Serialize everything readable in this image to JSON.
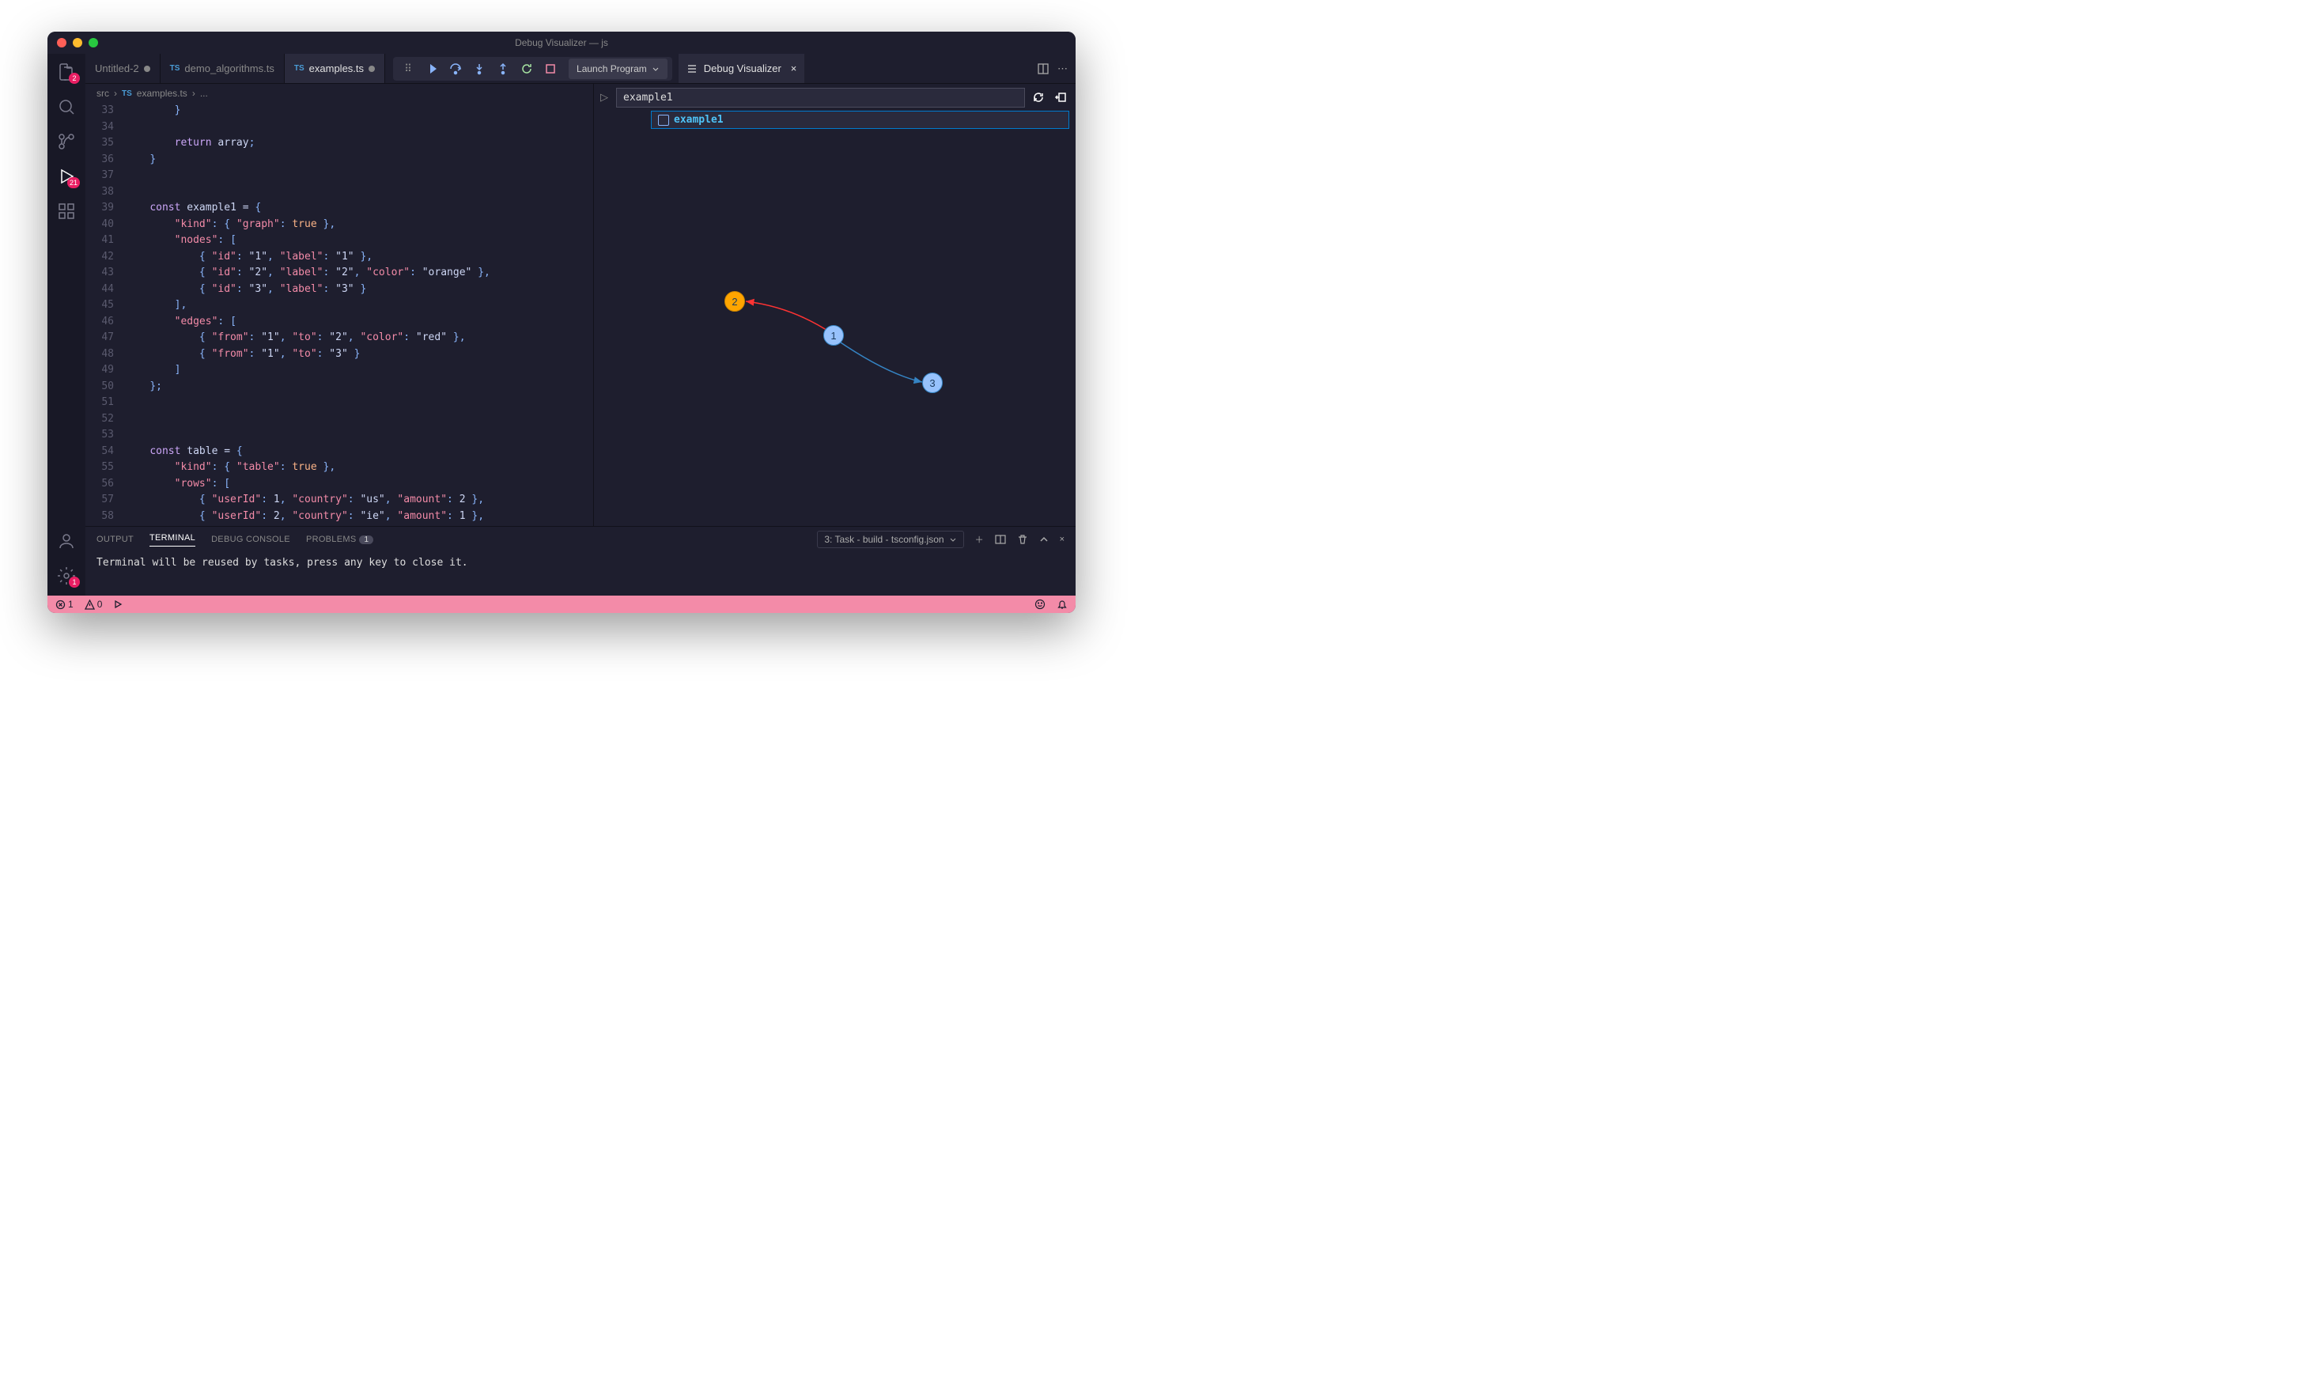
{
  "window_title": "Debug Visualizer — js",
  "activity": {
    "explorer_badge": "2",
    "debug_badge": "21",
    "settings_badge": "1"
  },
  "tabs": [
    {
      "label": "Untitled-2",
      "dirty": true,
      "ts": false
    },
    {
      "label": "demo_algorithms.ts",
      "dirty": false,
      "ts": true
    },
    {
      "label": "examples.ts",
      "dirty": true,
      "ts": true,
      "active": true
    }
  ],
  "debug_config": "Launch Program",
  "visual_tab": "Debug Visualizer",
  "breadcrumb": {
    "a": "src",
    "b": "examples.ts",
    "c": "..."
  },
  "code_lines": [
    {
      "n": "33",
      "t": "        }"
    },
    {
      "n": "34",
      "t": ""
    },
    {
      "n": "35",
      "t": "        return array;",
      "kw": "return"
    },
    {
      "n": "36",
      "t": "    }"
    },
    {
      "n": "37",
      "t": ""
    },
    {
      "n": "38",
      "t": ""
    },
    {
      "n": "39",
      "t": "    const example1 = {",
      "kw": "const"
    },
    {
      "n": "40",
      "t": "        \"kind\": { \"graph\": true },"
    },
    {
      "n": "41",
      "t": "        \"nodes\": ["
    },
    {
      "n": "42",
      "t": "            { \"id\": \"1\", \"label\": \"1\" },"
    },
    {
      "n": "43",
      "t": "            { \"id\": \"2\", \"label\": \"2\", \"color\": \"orange\" },"
    },
    {
      "n": "44",
      "t": "            { \"id\": \"3\", \"label\": \"3\" }"
    },
    {
      "n": "45",
      "t": "        ],"
    },
    {
      "n": "46",
      "t": "        \"edges\": ["
    },
    {
      "n": "47",
      "t": "            { \"from\": \"1\", \"to\": \"2\", \"color\": \"red\" },"
    },
    {
      "n": "48",
      "t": "            { \"from\": \"1\", \"to\": \"3\" }"
    },
    {
      "n": "49",
      "t": "        ]"
    },
    {
      "n": "50",
      "t": "    };"
    },
    {
      "n": "51",
      "t": ""
    },
    {
      "n": "52",
      "t": ""
    },
    {
      "n": "53",
      "t": ""
    },
    {
      "n": "54",
      "t": "    const table = {",
      "kw": "const"
    },
    {
      "n": "55",
      "t": "        \"kind\": { \"table\": true },"
    },
    {
      "n": "56",
      "t": "        \"rows\": ["
    },
    {
      "n": "57",
      "t": "            { \"userId\": 1, \"country\": \"us\", \"amount\": 2 },"
    },
    {
      "n": "58",
      "t": "            { \"userId\": 2, \"country\": \"ie\", \"amount\": 1 },"
    }
  ],
  "visual": {
    "expr": "example1",
    "suggest": "example1",
    "nodes": {
      "n1": "1",
      "n2": "2",
      "n3": "3"
    }
  },
  "panel": {
    "tabs": {
      "output": "OUTPUT",
      "terminal": "TERMINAL",
      "debug": "DEBUG CONSOLE",
      "problems": "PROBLEMS",
      "pcount": "1"
    },
    "task": "3: Task - build - tsconfig.json",
    "term_text": "Terminal will be reused by tasks, press any key to close it."
  },
  "status": {
    "err": "1",
    "warn": "0"
  }
}
